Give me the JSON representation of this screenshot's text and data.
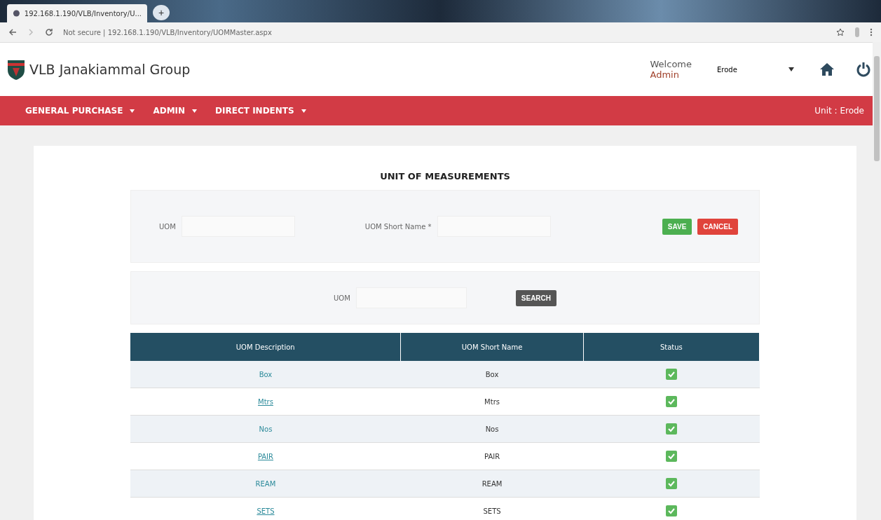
{
  "browser": {
    "tab_title": "192.168.1.190/VLB/Inventory/U...",
    "new_tab": "+",
    "address": "Not secure | 192.168.1.190/VLB/Inventory/UOMMaster.aspx"
  },
  "header": {
    "brand": "VLB Janakiammal Group",
    "welcome": "Welcome",
    "user": "Admin",
    "unit_select": "Erode"
  },
  "nav": {
    "items": [
      {
        "label": "GENERAL PURCHASE"
      },
      {
        "label": "ADMIN"
      },
      {
        "label": "DIRECT INDENTS"
      }
    ],
    "unit": "Unit : Erode"
  },
  "title": "UNIT OF MEASUREMENTS",
  "form": {
    "uom_label": "UOM",
    "short_name_label": "UOM Short Name *",
    "buttons": [
      {
        "label": "SAVE",
        "kind": "save"
      },
      {
        "label": "CANCEL",
        "kind": "cancel"
      }
    ]
  },
  "search": {
    "label": "UOM",
    "button": "SEARCH"
  },
  "table": {
    "columns": [
      "UOM Description",
      "UOM Short Name",
      "Status"
    ],
    "rows": [
      {
        "description": "Box",
        "short_name": "Box",
        "active": true
      },
      {
        "description": "Mtrs",
        "short_name": "Mtrs",
        "active": true
      },
      {
        "description": "Nos",
        "short_name": "Nos",
        "active": true
      },
      {
        "description": "PAIR",
        "short_name": "PAIR",
        "active": true
      },
      {
        "description": "REAM",
        "short_name": "REAM",
        "active": true
      },
      {
        "description": "SETS",
        "short_name": "SETS",
        "active": true
      }
    ]
  }
}
